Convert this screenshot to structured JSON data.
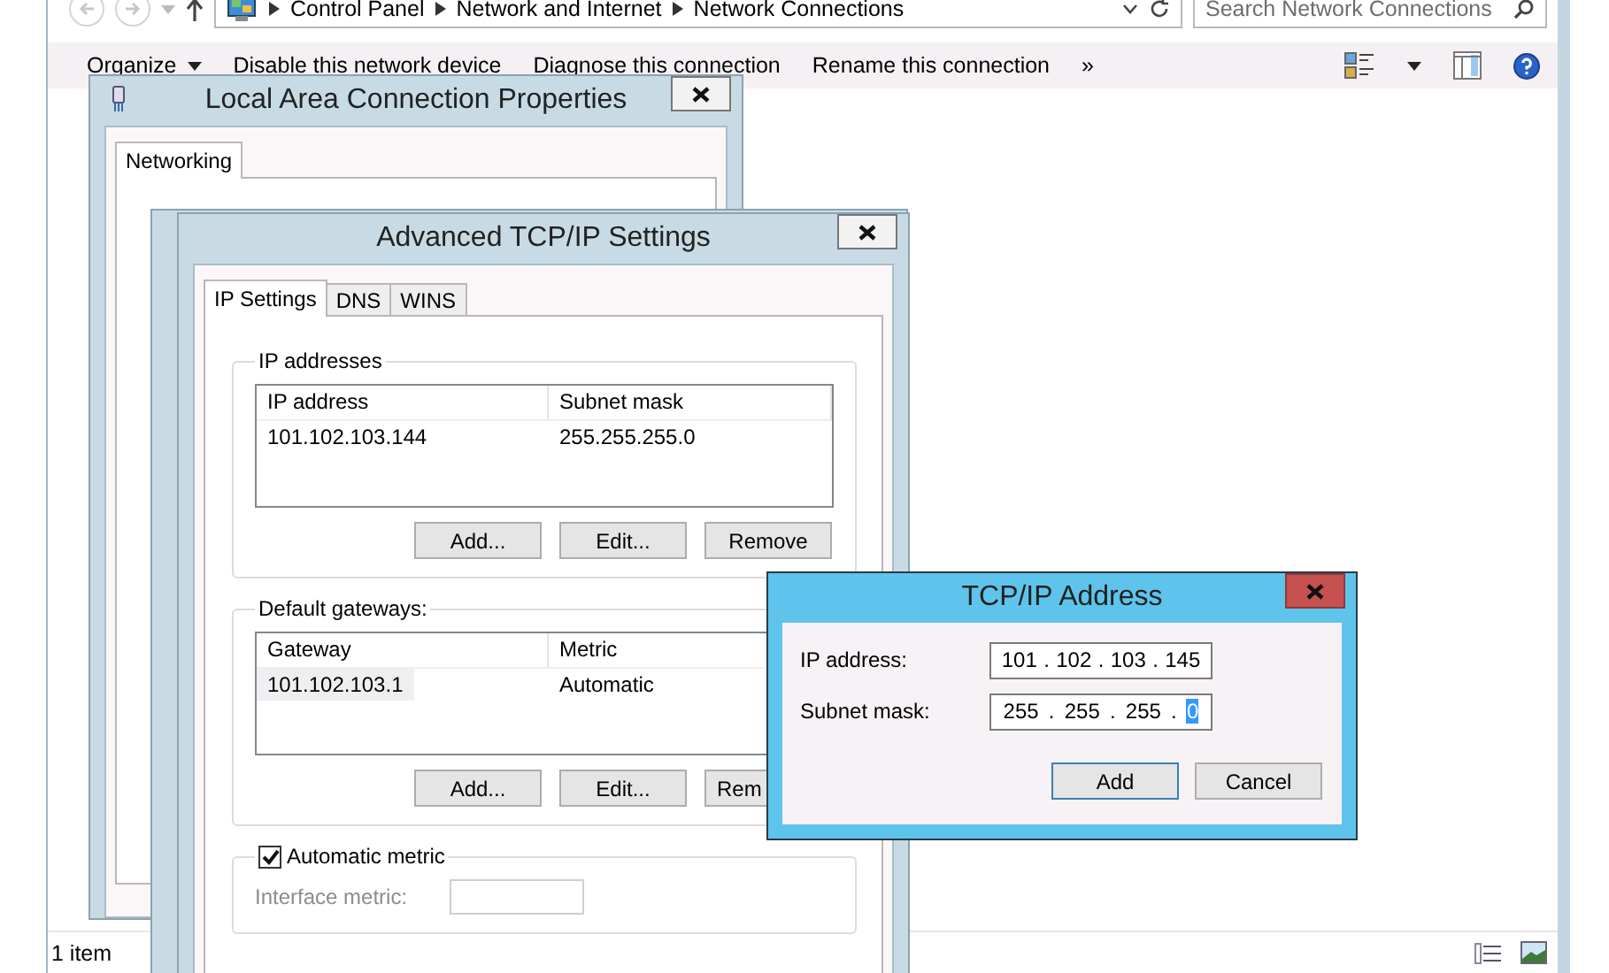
{
  "explorer": {
    "nav_buttons": [
      {
        "kind": "back",
        "disabled": true
      },
      {
        "kind": "forward",
        "disabled": true
      }
    ],
    "breadcrumb": [
      "Control Panel",
      "Network and Internet",
      "Network Connections"
    ],
    "search": {
      "placeholder": "Search Network Connections"
    },
    "commands": [
      {
        "label": "Organize",
        "dropdown": true
      },
      {
        "label": "Disable this network device",
        "dropdown": false
      },
      {
        "label": "Diagnose this connection",
        "dropdown": false
      },
      {
        "label": "Rename this connection",
        "dropdown": false
      },
      {
        "label": "»",
        "dropdown": false
      }
    ],
    "status_bar": {
      "text": "1 item"
    }
  },
  "properties_dialog": {
    "title": "Local Area Connection Properties",
    "tabs": [
      {
        "label": "Networking",
        "selected": true
      }
    ]
  },
  "advanced_dialog": {
    "title": "Advanced TCP/IP Settings",
    "tabs": [
      {
        "label": "IP Settings",
        "selected": true
      },
      {
        "label": "DNS",
        "selected": false
      },
      {
        "label": "WINS",
        "selected": false
      }
    ],
    "ip_group": {
      "title": "IP addresses",
      "columns": [
        "IP address",
        "Subnet mask"
      ],
      "rows": [
        {
          "cells": [
            "101.102.103.144",
            "255.255.255.0"
          ],
          "selected": false
        }
      ],
      "buttons": [
        "Add...",
        "Edit...",
        "Remove"
      ]
    },
    "gateway_group": {
      "title": "Default gateways:",
      "columns": [
        "Gateway",
        "Metric"
      ],
      "rows": [
        {
          "cells": [
            "101.102.103.1",
            "Automatic"
          ],
          "selected": true
        }
      ],
      "buttons": [
        "Add...",
        "Edit...",
        "Rem"
      ]
    },
    "metric": {
      "label": "Automatic metric",
      "checked": true,
      "field_label": "Interface metric:",
      "disabled": true
    }
  },
  "address_dialog": {
    "title": "TCP/IP Address",
    "separator": ".",
    "fields": [
      {
        "label": "IP address:",
        "octets": [
          {
            "value": "101",
            "selected": false
          },
          {
            "value": "102",
            "selected": false
          },
          {
            "value": "103",
            "selected": false
          },
          {
            "value": "145",
            "selected": false
          }
        ]
      },
      {
        "label": "Subnet mask:",
        "octets": [
          {
            "value": "255",
            "selected": false
          },
          {
            "value": "255",
            "selected": false
          },
          {
            "value": "255",
            "selected": false
          },
          {
            "value": "0",
            "selected": true
          }
        ]
      }
    ],
    "buttons": [
      {
        "label": "Add",
        "default": true
      },
      {
        "label": "Cancel",
        "default": false
      }
    ]
  }
}
